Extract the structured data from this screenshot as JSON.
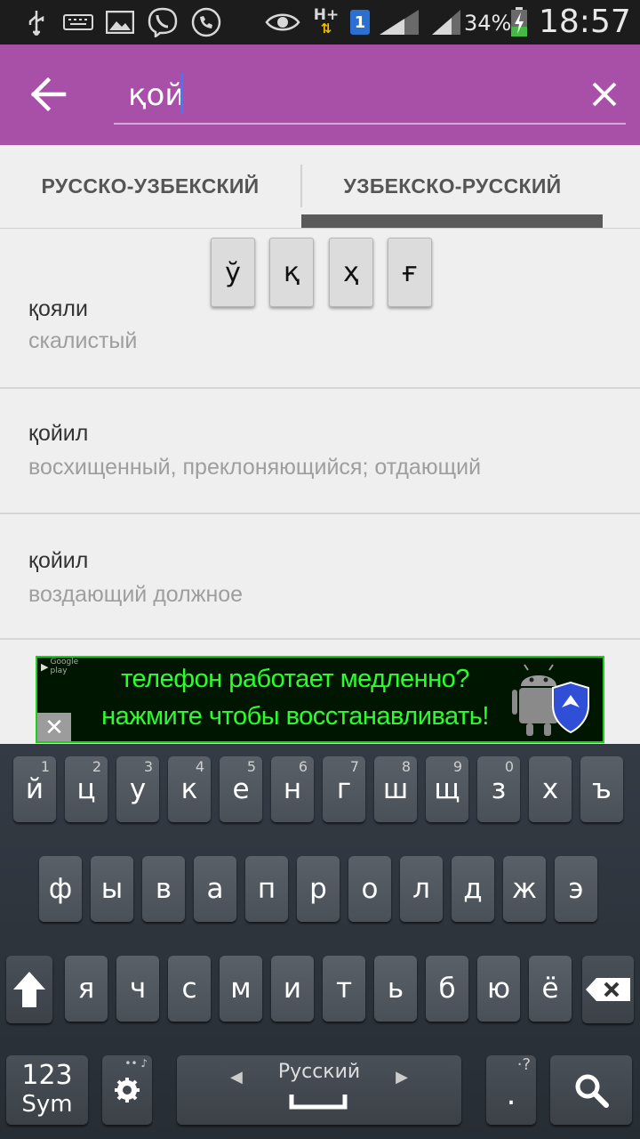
{
  "status_bar": {
    "battery_percent": "34%",
    "time": "18:57",
    "network": "H+",
    "sim": "1"
  },
  "toolbar": {
    "search_value": "қой",
    "back_icon": "arrow-back-icon",
    "clear_icon": "close-icon"
  },
  "tabs": [
    {
      "label": "РУССКО-УЗБЕКСКИЙ",
      "selected": false
    },
    {
      "label": "УЗБЕКСКО-РУССКИЙ",
      "selected": true
    }
  ],
  "special_chars": [
    "ў",
    "қ",
    "ҳ",
    "ғ"
  ],
  "results": [
    {
      "word": "қояли",
      "translation": "скалистый"
    },
    {
      "word": "қойил",
      "translation": "восхищенный, преклоняющийся; отдающий"
    },
    {
      "word": "қойил",
      "translation": "воздающий должное"
    }
  ],
  "ad": {
    "line1": "телефон работает медленно?",
    "line2": "нажмите чтобы восстанавливать!",
    "badge": "Google play",
    "close": "✕"
  },
  "keyboard": {
    "row1": [
      {
        "key": "й",
        "hint": "1"
      },
      {
        "key": "ц",
        "hint": "2"
      },
      {
        "key": "у",
        "hint": "3"
      },
      {
        "key": "к",
        "hint": "4"
      },
      {
        "key": "е",
        "hint": "5"
      },
      {
        "key": "н",
        "hint": "6"
      },
      {
        "key": "г",
        "hint": "7"
      },
      {
        "key": "ш",
        "hint": "8"
      },
      {
        "key": "щ",
        "hint": "9"
      },
      {
        "key": "з",
        "hint": "0"
      },
      {
        "key": "х",
        "hint": ""
      },
      {
        "key": "ъ",
        "hint": ""
      }
    ],
    "row2": [
      "ф",
      "ы",
      "в",
      "а",
      "п",
      "р",
      "о",
      "л",
      "д",
      "ж",
      "э"
    ],
    "row3": [
      "я",
      "ч",
      "с",
      "м",
      "и",
      "т",
      "ь",
      "б",
      "ю",
      "ё"
    ],
    "sym_top": "123",
    "sym_bottom": "Sym",
    "space_label": "Русский",
    "period": ".",
    "period_hint": "·?"
  }
}
